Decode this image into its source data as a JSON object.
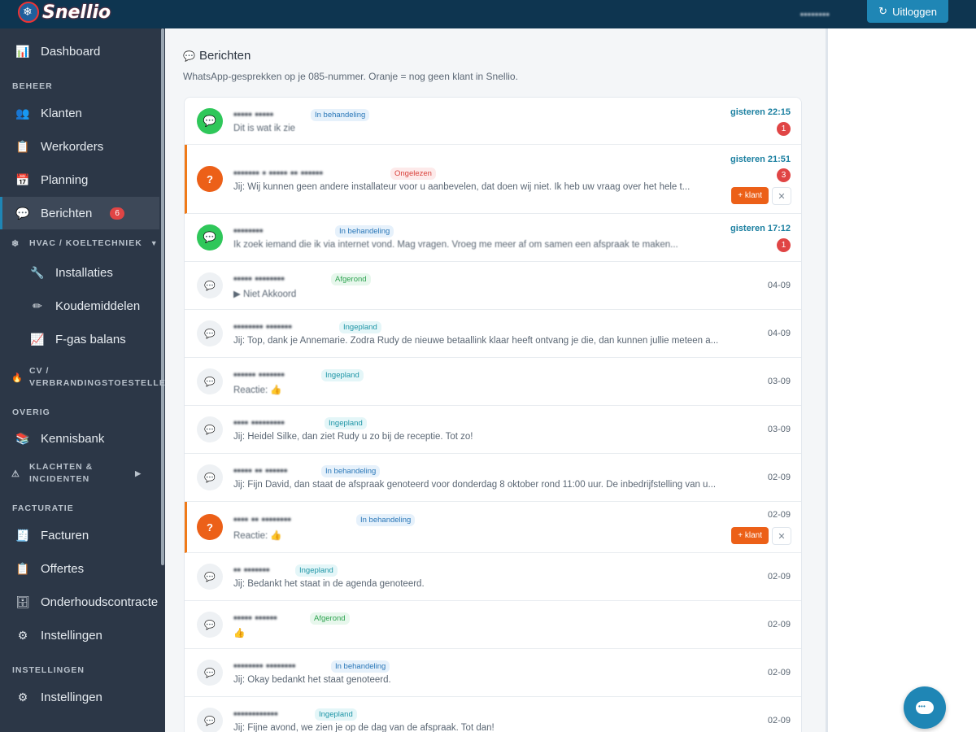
{
  "brand": {
    "name": "Snellio",
    "accent": "#1f86b5",
    "topbar": "#0e3550"
  },
  "header": {
    "user_name": "••••••••",
    "logout_label": "Uitloggen",
    "logout_icon": "logout-icon"
  },
  "sidebar": {
    "items": {
      "dashboard": "Dashboard",
      "klanten": "Klanten",
      "werkorders": "Werkorders",
      "planning": "Planning",
      "berichten": "Berichten",
      "berichten_badge": "6",
      "installaties": "Installaties",
      "koudemiddelen": "Koudemiddelen",
      "fgas": "F-gas balans",
      "kennisbank": "Kennisbank",
      "facturen": "Facturen",
      "offertes": "Offertes",
      "onderhoud": "Onderhoudscontracte",
      "instellingen1": "Instellingen",
      "instellingen2": "Instellingen"
    },
    "sections": {
      "beheer": "BEHEER",
      "overig": "OVERIG",
      "facturatie": "FACTURATIE",
      "instellingen": "INSTELLINGEN"
    },
    "groups": {
      "hvac": "HVAC / KOELTECHNIEK",
      "cv": "CV / VERBRANDINGSTOESTELLEN",
      "klachten": "KLACHTEN & INCIDENTEN"
    }
  },
  "main": {
    "title": "Berichten",
    "subtitle": "WhatsApp-gesprekken op je 085-nummer. Oranje = nog geen klant in Snellio.",
    "klant_label": "+ klant",
    "dismiss_label": "✕",
    "conversations": [
      {
        "name": "••••• •••••",
        "status": "In behandeling",
        "preview": "Dit is wat ik zie",
        "time": "gisteren 22:15",
        "unread": "1"
      },
      {
        "name": "••••••• • ••••• •• ••••••",
        "status": "Ongelezen",
        "preview": "Jij: Wij kunnen geen andere installateur voor u aanbevelen, dat doen wij niet. Ik heb uw vraag over het hele t...",
        "time": "gisteren 21:51",
        "unread": "3"
      },
      {
        "name": "••••••••",
        "status": "In behandeling",
        "preview": "Ik zoek iemand die ik via internet vond. Mag vragen. Vroeg me meer af om samen een afspraak te maken...",
        "time": "gisteren 17:12",
        "unread": "1"
      },
      {
        "name": "••••• ••••••••",
        "status": "Afgerond",
        "preview": "▶ Niet Akkoord",
        "time": "04-09"
      },
      {
        "name": "•••••••• •••••••",
        "status": "Ingepland",
        "preview": "Jij: Top, dank je Annemarie. Zodra Rudy de nieuwe betaallink klaar heeft ontvang je die, dan kunnen jullie meteen a...",
        "time": "04-09"
      },
      {
        "name": "•••••• •••••••",
        "status": "Ingepland",
        "preview": "Reactie: 👍",
        "time": "03-09"
      },
      {
        "name": "•••• •••••••••",
        "status": "Ingepland",
        "preview": "Jij: Heidel Silke, dan ziet Rudy u zo bij de receptie. Tot zo!",
        "time": "03-09"
      },
      {
        "name": "••••• •• ••••••",
        "status": "In behandeling",
        "preview": "Jij: Fijn David, dan staat de afspraak genoteerd voor donderdag 8 oktober rond 11:00 uur. De inbedrijfstelling van u...",
        "time": "02-09"
      },
      {
        "name": "•••• •• ••••••••",
        "status": "In behandeling",
        "preview": "Reactie: 👍",
        "time": "02-09"
      },
      {
        "name": "•• •••••••",
        "status": "Ingepland",
        "preview": "Jij: Bedankt het staat in de agenda genoteerd.",
        "time": "02-09"
      },
      {
        "name": "••••• ••••••",
        "status": "Afgerond",
        "preview": "👍",
        "time": "02-09"
      },
      {
        "name": "•••••••• ••••••••",
        "status": "In behandeling",
        "preview": "Jij: Okay bedankt het staat genoteerd.",
        "time": "02-09"
      },
      {
        "name": "••••••••••••",
        "status": "Ingepland",
        "preview": "Jij: Fijne avond, we zien je op de dag van de afspraak. Tot dan!",
        "time": "02-09"
      }
    ]
  }
}
